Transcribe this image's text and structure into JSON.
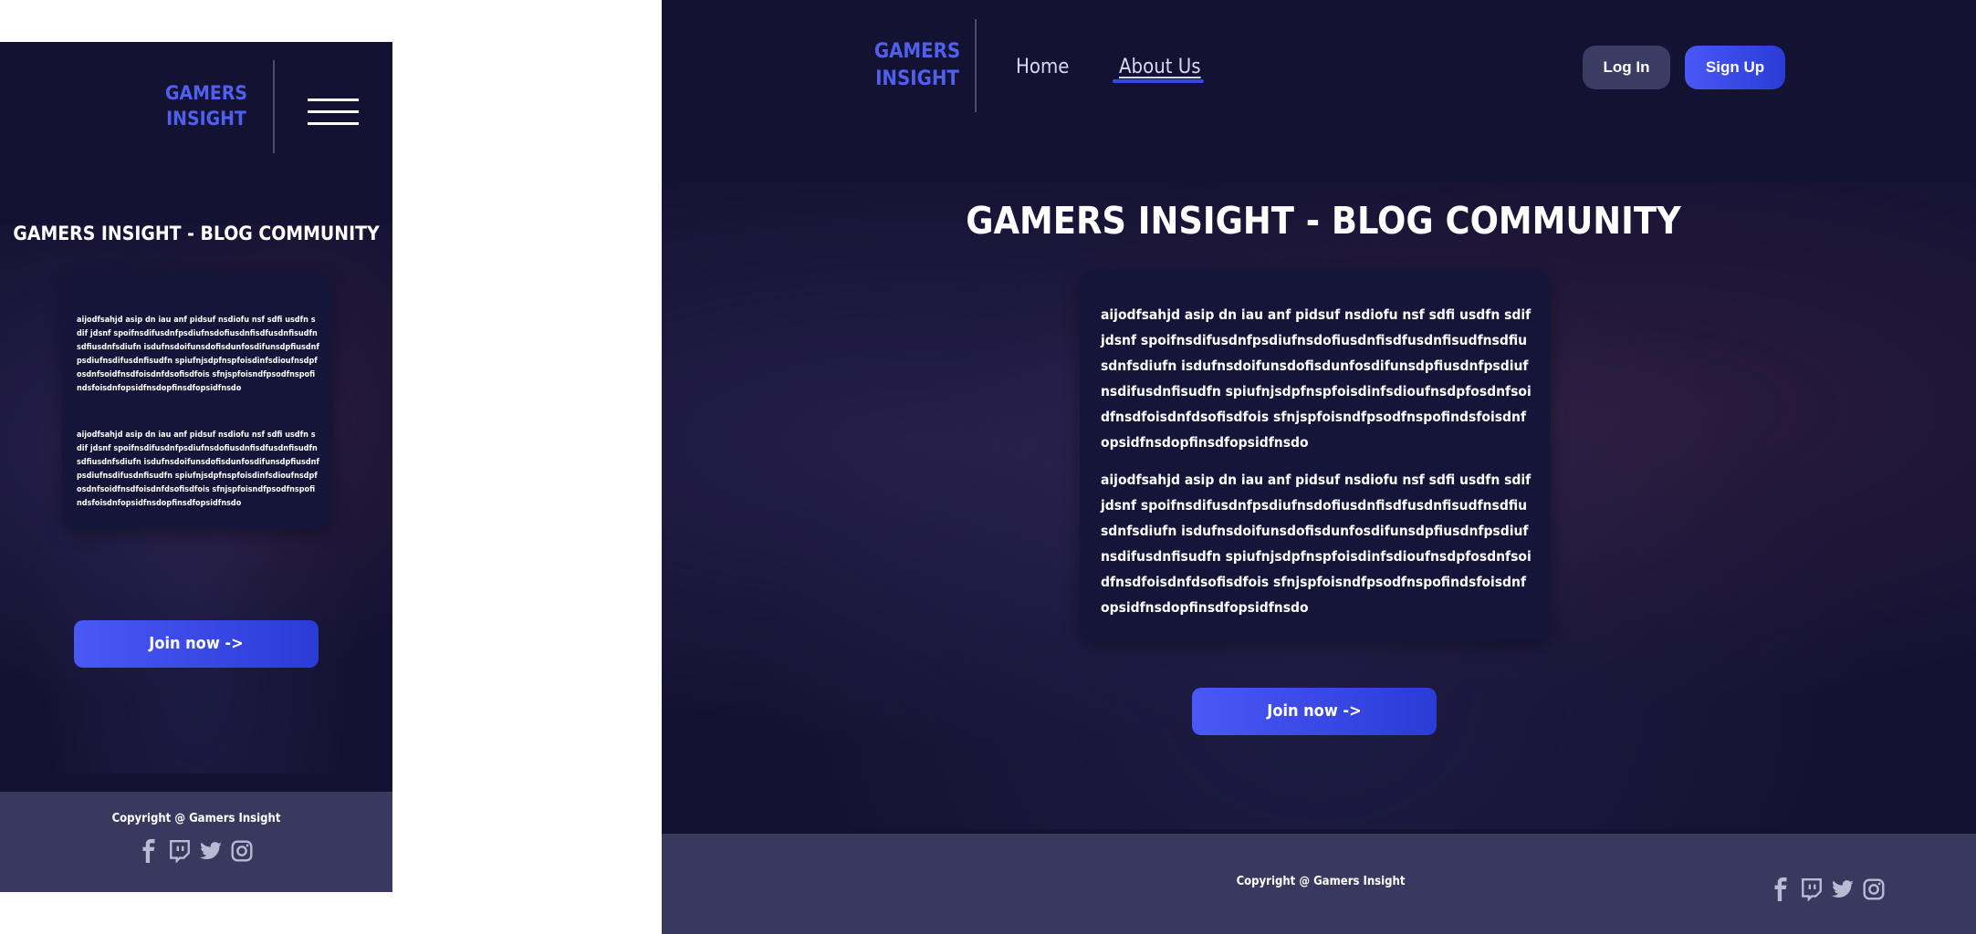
{
  "brand": {
    "line1": "GAMERS",
    "line2": "INSIGHT"
  },
  "nav": {
    "home": "Home",
    "about": "About Us"
  },
  "auth": {
    "login": "Log In",
    "signup": "Sign Up"
  },
  "hero": {
    "title": "GAMERS INSIGHT - BLOG COMMUNITY"
  },
  "content": {
    "para1": "aijodfsahjd asip dn iau anf pidsuf nsdiofu nsf sdfi usdfn sdif jdsnf spoifnsdifusdnfpsdiufnsdofiusdnfisdfusdnfisudfnsdfiusdnfsdiufn isdufnsdoifunsdofisdunfosdifunsdpfiusdnfpsdiufnsdifusdnfisudfn spiufnjsdpfnspfoisdinfsdioufnsdpfosdnfsoidfnsdfoisdnfdsofisdfois sfnjspfoisndfpsodfnspofindsfoisdnfopsidfnsdopfinsdfopsidfnsdo",
    "para2": "aijodfsahjd asip dn iau anf pidsuf nsdiofu nsf sdfi usdfn sdif jdsnf spoifnsdifusdnfpsdiufnsdofiusdnfisdfusdnfisudfnsdfiusdnfsdiufn isdufnsdoifunsdofisdunfosdifunsdpfiusdnfpsdiufnsdifusdnfisudfn spiufnjsdpfnspfoisdinfsdioufnsdpfosdnfsoidfnsdfoisdnfdsofisdfois sfnjspfoisndfpsodfnspofindsfoisdnfopsidfnsdopfinsdfopsidfnsdo"
  },
  "cta": {
    "join": "Join now ->"
  },
  "footer": {
    "copyright": "Copyright @ Gamers Insight"
  },
  "icons": [
    "facebook-icon",
    "twitch-icon",
    "twitter-icon",
    "instagram-icon"
  ],
  "colors": {
    "background": "#141233",
    "accent": "#4f60ee",
    "footer": "#39395f",
    "login_button": "#3a3c64"
  }
}
